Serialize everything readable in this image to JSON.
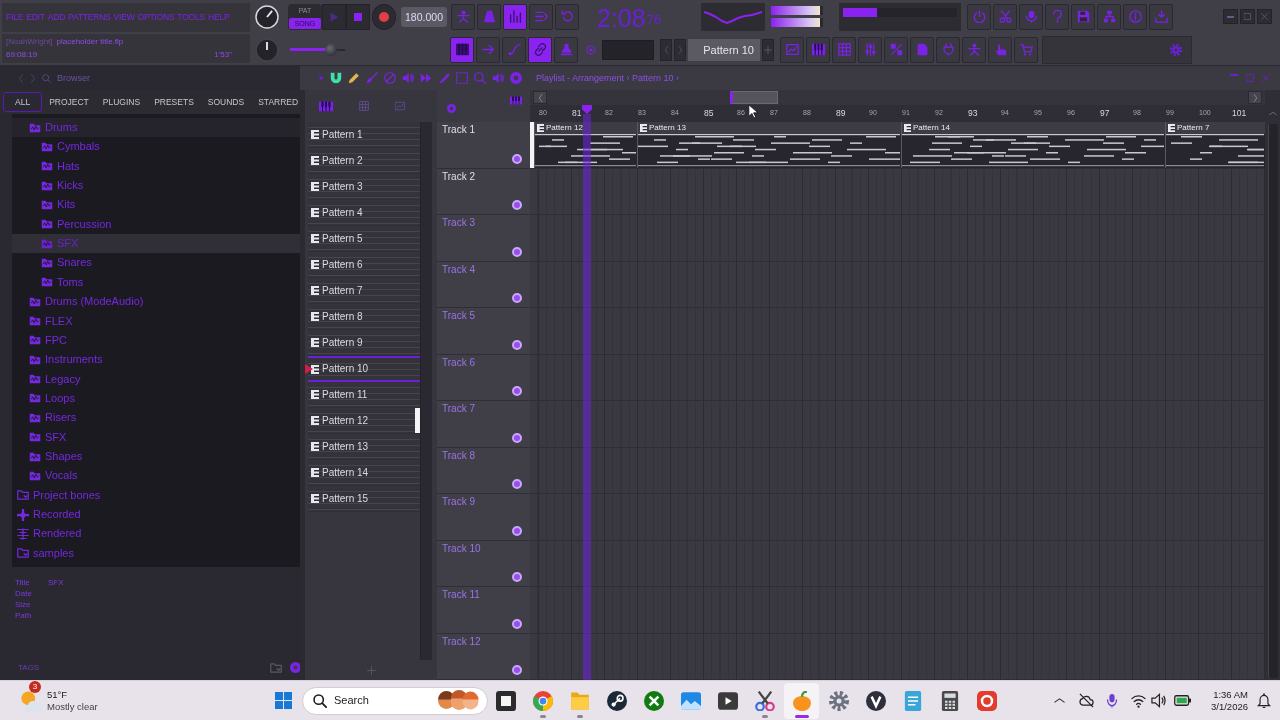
{
  "menu": [
    "FILE",
    "EDIT",
    "ADD",
    "PATTERNS",
    "VIEW",
    "OPTIONS",
    "TOOLS",
    "HELP"
  ],
  "project": {
    "user": "[NoahWright]",
    "file": "placeholder title.flp",
    "position": "69:08:19",
    "length": "1'53\""
  },
  "mode": [
    {
      "label": "PAT",
      "selected": false
    },
    {
      "label": "SONG",
      "selected": true
    }
  ],
  "tempo": "180.000",
  "tool_buttons": [
    {
      "active": false
    },
    {
      "active": false
    },
    {
      "active": true
    },
    {
      "active": false
    },
    {
      "active": false
    }
  ],
  "song_time": {
    "value": "2:08",
    "fraction": "76"
  },
  "peak_meters": [
    {
      "level": 0.95
    },
    {
      "level": 0.95
    }
  ],
  "cpu_meter": {
    "level": 0.3
  },
  "pitch_slider": {
    "level": 0.75
  },
  "edit_buttons": [
    {
      "active": true
    },
    {
      "active": false
    },
    {
      "active": false
    },
    {
      "active": true
    },
    {
      "active": false
    }
  ],
  "pattern_selector": {
    "value": "Pattern 10"
  },
  "browser": {
    "title": "Browser",
    "tabs": [
      {
        "label": "ALL",
        "selected": true
      },
      {
        "label": "PROJECT",
        "selected": false
      },
      {
        "label": "PLUGINS",
        "selected": false
      },
      {
        "label": "PRESETS",
        "selected": false
      },
      {
        "label": "SOUNDS",
        "selected": false
      },
      {
        "label": "STARRED",
        "selected": false
      }
    ],
    "packs": [
      {
        "label": "Drums",
        "expanded": true,
        "selected": false,
        "children": [
          {
            "label": "Cymbals",
            "selected": false
          },
          {
            "label": "Hats",
            "selected": false
          },
          {
            "label": "Kicks",
            "selected": false
          },
          {
            "label": "Kits",
            "selected": false
          },
          {
            "label": "Percussion",
            "selected": false
          },
          {
            "label": "SFX",
            "selected": true
          },
          {
            "label": "Snares",
            "selected": false
          },
          {
            "label": "Toms",
            "selected": false
          }
        ]
      },
      {
        "label": "Drums (ModeAudio)",
        "expanded": false,
        "selected": false
      },
      {
        "label": "FLEX",
        "expanded": false,
        "selected": false
      },
      {
        "label": "FPC",
        "expanded": false,
        "selected": false
      },
      {
        "label": "Instruments",
        "expanded": false,
        "selected": false
      },
      {
        "label": "Legacy",
        "expanded": false,
        "selected": false
      },
      {
        "label": "Loops",
        "expanded": false,
        "selected": false
      },
      {
        "label": "Risers",
        "expanded": false,
        "selected": false
      },
      {
        "label": "SFX",
        "expanded": false,
        "selected": false
      },
      {
        "label": "Shapes",
        "expanded": false,
        "selected": false
      },
      {
        "label": "Vocals",
        "expanded": false,
        "selected": false
      }
    ],
    "folders": [
      {
        "label": "Project bones",
        "kind": "folder",
        "selected": false
      },
      {
        "label": "Recorded",
        "kind": "recorded",
        "selected": false
      },
      {
        "label": "Rendered",
        "kind": "rendered",
        "selected": false
      },
      {
        "label": "samples",
        "kind": "folder",
        "selected": false
      }
    ],
    "info": [
      {
        "label": "Title",
        "value": "SFX"
      },
      {
        "label": "Date"
      },
      {
        "label": "Size"
      },
      {
        "label": "Path"
      }
    ],
    "footer": "TAGS"
  },
  "playlist": {
    "title": "Playlist - Arrangement › Pattern 10 ›",
    "patterns": [
      {
        "name": "Pattern 1",
        "selected": false,
        "marked": false
      },
      {
        "name": "Pattern 2",
        "selected": false,
        "marked": false
      },
      {
        "name": "Pattern 3",
        "selected": false,
        "marked": false
      },
      {
        "name": "Pattern 4",
        "selected": false,
        "marked": false
      },
      {
        "name": "Pattern 5",
        "selected": false,
        "marked": false
      },
      {
        "name": "Pattern 6",
        "selected": false,
        "marked": false
      },
      {
        "name": "Pattern 7",
        "selected": false,
        "marked": false
      },
      {
        "name": "Pattern 8",
        "selected": false,
        "marked": false
      },
      {
        "name": "Pattern 9",
        "selected": false,
        "marked": false
      },
      {
        "name": "Pattern 10",
        "selected": true,
        "marked": false
      },
      {
        "name": "Pattern 11",
        "selected": false,
        "marked": false
      },
      {
        "name": "Pattern 12",
        "selected": false,
        "marked": true
      },
      {
        "name": "Pattern 13",
        "selected": false,
        "marked": false
      },
      {
        "name": "Pattern 14",
        "selected": false,
        "marked": false
      },
      {
        "name": "Pattern 15",
        "selected": false,
        "marked": false
      }
    ],
    "ruler": [
      "80",
      "81",
      "82",
      "83",
      "84",
      "85",
      "86",
      "87",
      "88",
      "89",
      "90",
      "91",
      "92",
      "93",
      "94",
      "95",
      "96",
      "97",
      "98",
      "99",
      "100",
      "101"
    ],
    "tracks": [
      {
        "name": "Track 1",
        "used": true,
        "selected": true,
        "clips": [
          {
            "name": "Pattern 12"
          },
          {
            "name": "Pattern 13"
          },
          {
            "name": "Pattern 14"
          },
          {
            "name": "Pattern 7"
          }
        ]
      },
      {
        "name": "Track 2",
        "used": true,
        "selected": false
      },
      {
        "name": "Track 3",
        "used": false,
        "selected": false
      },
      {
        "name": "Track 4",
        "used": false,
        "selected": false
      },
      {
        "name": "Track 5",
        "used": false,
        "selected": false
      },
      {
        "name": "Track 6",
        "used": false,
        "selected": false
      },
      {
        "name": "Track 7",
        "used": false,
        "selected": false
      },
      {
        "name": "Track 8",
        "used": false,
        "selected": false
      },
      {
        "name": "Track 9",
        "used": false,
        "selected": false
      },
      {
        "name": "Track 10",
        "used": false,
        "selected": false
      },
      {
        "name": "Track 11",
        "used": false,
        "selected": false
      },
      {
        "name": "Track 12",
        "used": false,
        "selected": false
      }
    ]
  },
  "taskbar": {
    "weather": {
      "temperature": "51°F",
      "condition": "Mostly clear",
      "badge": "3"
    },
    "search": {
      "placeholder": "Search"
    },
    "apps": [
      {
        "running": false,
        "active": false
      },
      {
        "running": true,
        "active": false
      },
      {
        "running": true,
        "active": false
      },
      {
        "running": false,
        "active": false
      },
      {
        "running": false,
        "active": false
      },
      {
        "running": false,
        "active": false
      },
      {
        "running": false,
        "active": false
      },
      {
        "running": true,
        "active": false
      },
      {
        "running": true,
        "active": true
      },
      {
        "running": false,
        "active": false
      },
      {
        "running": false,
        "active": false
      },
      {
        "running": false,
        "active": false
      },
      {
        "running": false,
        "active": false
      },
      {
        "running": false,
        "active": false
      }
    ],
    "clock": {
      "time": "1:36 AM",
      "date": "3/1/2026"
    }
  }
}
